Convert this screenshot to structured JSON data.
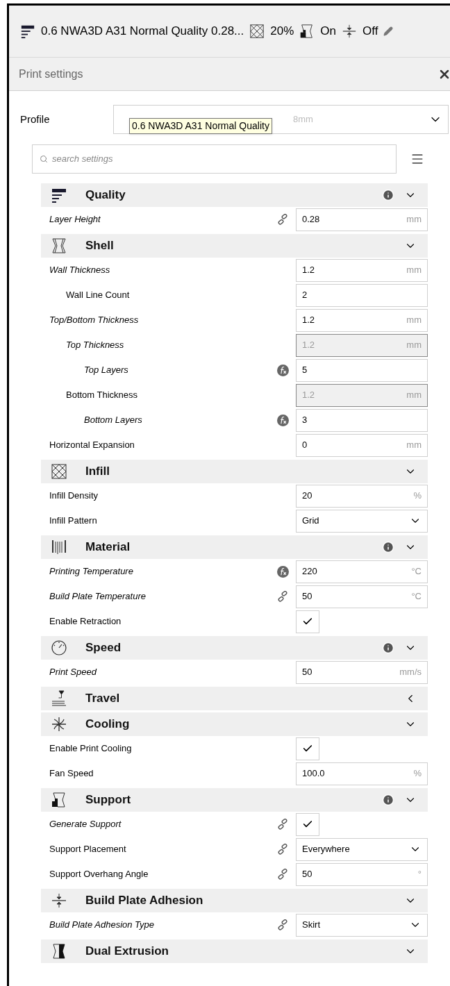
{
  "toolbar": {
    "profile": "0.6 NWA3D A31 Normal Quality 0.28...",
    "infill": "20%",
    "support": "On",
    "adhesion": "Off"
  },
  "panel": {
    "title": "Print settings"
  },
  "profile": {
    "label": "Profile",
    "value": "8mm",
    "tooltip": "0.6 NWA3D A31 Normal Quality"
  },
  "search": {
    "placeholder": "search settings"
  },
  "sections": [
    {
      "title": "Quality",
      "info": true,
      "expanded": true,
      "settings": [
        {
          "label": "Layer Height",
          "kind": "number",
          "value": "0.28",
          "unit": "mm",
          "user_set": true,
          "linked": true
        }
      ]
    },
    {
      "title": "Shell",
      "info": false,
      "expanded": true,
      "settings": [
        {
          "label": "Wall Thickness",
          "kind": "number",
          "value": "1.2",
          "unit": "mm",
          "user_set": true,
          "children": [
            {
              "label": "Wall Line Count",
              "kind": "number",
              "value": "2",
              "user_set": false
            }
          ]
        },
        {
          "label": "Top/Bottom Thickness",
          "kind": "number",
          "value": "1.2",
          "unit": "mm",
          "user_set": true,
          "children": [
            {
              "label": "Top Thickness",
              "kind": "number",
              "value": "1.2",
              "unit": "mm",
              "user_set": true,
              "disabled": true,
              "children": [
                {
                  "label": "Top Layers",
                  "kind": "number",
                  "value": "5",
                  "user_set": true,
                  "formula": true
                }
              ]
            },
            {
              "label": "Bottom Thickness",
              "kind": "number",
              "value": "1.2",
              "unit": "mm",
              "user_set": false,
              "disabled": true,
              "children": [
                {
                  "label": "Bottom Layers",
                  "kind": "number",
                  "value": "3",
                  "user_set": true,
                  "formula": true
                }
              ]
            }
          ]
        },
        {
          "label": "Horizontal Expansion",
          "kind": "number",
          "value": "0",
          "unit": "mm",
          "user_set": false
        }
      ]
    },
    {
      "title": "Infill",
      "info": false,
      "expanded": true,
      "settings": [
        {
          "label": "Infill Density",
          "kind": "number",
          "value": "20",
          "unit": "%",
          "user_set": false
        },
        {
          "label": "Infill Pattern",
          "kind": "select",
          "value": "Grid",
          "user_set": false
        }
      ]
    },
    {
      "title": "Material",
      "info": true,
      "expanded": true,
      "settings": [
        {
          "label": "Printing Temperature",
          "kind": "number",
          "value": "220",
          "unit": "°C",
          "user_set": true,
          "formula": true
        },
        {
          "label": "Build Plate Temperature",
          "kind": "number",
          "value": "50",
          "unit": "°C",
          "user_set": true,
          "linked": true
        },
        {
          "label": "Enable Retraction",
          "kind": "checkbox",
          "checked": true,
          "user_set": false
        }
      ]
    },
    {
      "title": "Speed",
      "info": true,
      "expanded": true,
      "settings": [
        {
          "label": "Print Speed",
          "kind": "number",
          "value": "50",
          "unit": "mm/s",
          "user_set": true
        }
      ]
    },
    {
      "title": "Travel",
      "info": false,
      "expanded": false
    },
    {
      "title": "Cooling",
      "info": false,
      "expanded": true,
      "settings": [
        {
          "label": "Enable Print Cooling",
          "kind": "checkbox",
          "checked": true,
          "user_set": false
        },
        {
          "label": "Fan Speed",
          "kind": "number",
          "value": "100.0",
          "unit": "%",
          "user_set": false
        }
      ]
    },
    {
      "title": "Support",
      "info": true,
      "expanded": true,
      "settings": [
        {
          "label": "Generate Support",
          "kind": "checkbox",
          "checked": true,
          "user_set": true,
          "linked": true
        },
        {
          "label": "Support Placement",
          "kind": "select",
          "value": "Everywhere",
          "user_set": false,
          "linked": true
        },
        {
          "label": "Support Overhang Angle",
          "kind": "number",
          "value": "50",
          "unit": "°",
          "user_set": false,
          "linked": true
        }
      ]
    },
    {
      "title": "Build Plate Adhesion",
      "info": false,
      "expanded": true,
      "settings": [
        {
          "label": "Build Plate Adhesion Type",
          "kind": "select",
          "value": "Skirt",
          "user_set": true,
          "linked": true
        }
      ]
    },
    {
      "title": "Dual Extrusion",
      "info": false,
      "expanded": true
    }
  ]
}
